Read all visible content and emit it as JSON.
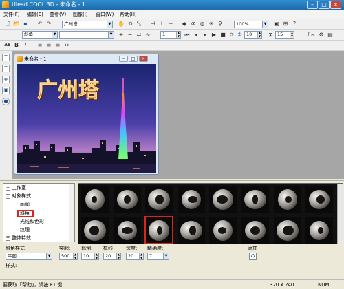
{
  "window": {
    "title": "Ulead COOL 3D - 未命名 - 1"
  },
  "menu": [
    "文件(F)",
    "编辑(E)",
    "查看(V)",
    "图像(I)",
    "窗口(W)",
    "帮助(H)"
  ],
  "toolbar1": {
    "font_combo": "广州塔",
    "zoom_combo": "100%"
  },
  "toolbar2": {
    "style_combo": "斜角",
    "frame_value": "1",
    "time_value": "10",
    "fps_value": "15",
    "fps_label": "fps"
  },
  "doc": {
    "title": "未命名 - 1",
    "caption_text": "广州塔"
  },
  "tree": {
    "items": [
      {
        "label": "工作室",
        "sign": "+"
      },
      {
        "label": "对象样式",
        "sign": "-"
      },
      {
        "label": "画廊"
      },
      {
        "label": "斜角"
      },
      {
        "label": "光线和色彩"
      },
      {
        "label": "纹理"
      },
      {
        "label": "整体特效",
        "sign": "+"
      }
    ],
    "selected": "斜角"
  },
  "gallery": {
    "rows": 2,
    "cols": 8,
    "selected_index": 10
  },
  "controls": {
    "bevel_style_label": "斜角样式",
    "bevel_style_value": "平面",
    "protrude_label": "突起:",
    "protrude_value": "500",
    "scale_label": "比例:",
    "scale_value": "10",
    "border_label": "框线",
    "border_value": "20",
    "depth_label": "深度:",
    "depth_value": "20",
    "precision_label": "精确度:",
    "precision_value": "7",
    "add_label": "添加",
    "style_field_label": "样式:"
  },
  "status": {
    "help": "要获取「帮助」，请按 F1 键",
    "size": "320 x 240",
    "num": "NUM"
  },
  "colors": {
    "titlebar": "#1e6aaa",
    "workspace": "#a6a6a6",
    "highlight": "#d6261e"
  }
}
